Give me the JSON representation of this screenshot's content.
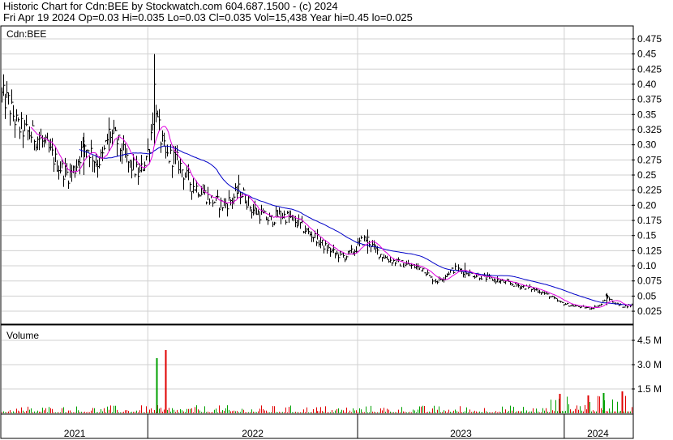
{
  "header": {
    "line1": "Historic Chart for Cdn:BEE by Stockwatch.com 604.687.1500 - (c) 2024",
    "line2": "Fri Apr 19 2024  Op=0.03  Hi=0.035  Lo=0.03  Cl=0.035  Vol=15,438  Year hi=0.45  lo=0.025"
  },
  "chart_data": [
    {
      "type": "ohlc-line",
      "ticker_label": "Cdn:BEE",
      "y_ticks": [
        "0.475",
        "0.45",
        "0.425",
        "0.40",
        "0.375",
        "0.35",
        "0.325",
        "0.30",
        "0.275",
        "0.25",
        "0.225",
        "0.20",
        "0.175",
        "0.15",
        "0.125",
        "0.10",
        "0.075",
        "0.05",
        "0.025"
      ],
      "ylim": [
        0.005,
        0.495
      ],
      "price_color": "#000000",
      "ma_short_color": "#e000e0",
      "ma_long_color": "#0000c8",
      "x_year_labels": [
        "2021",
        "2022",
        "2023",
        "2024"
      ],
      "x_year_boundaries": [
        0.232,
        0.565,
        0.893
      ],
      "price_anchors": [
        [
          0.0,
          0.38
        ],
        [
          0.01,
          0.37
        ],
        [
          0.025,
          0.33
        ],
        [
          0.04,
          0.32
        ],
        [
          0.06,
          0.31
        ],
        [
          0.075,
          0.29
        ],
        [
          0.09,
          0.265
        ],
        [
          0.105,
          0.25
        ],
        [
          0.115,
          0.26
        ],
        [
          0.13,
          0.3
        ],
        [
          0.14,
          0.29
        ],
        [
          0.15,
          0.27
        ],
        [
          0.16,
          0.28
        ],
        [
          0.17,
          0.32
        ],
        [
          0.18,
          0.31
        ],
        [
          0.19,
          0.29
        ],
        [
          0.2,
          0.27
        ],
        [
          0.21,
          0.26
        ],
        [
          0.218,
          0.25
        ],
        [
          0.225,
          0.27
        ],
        [
          0.232,
          0.29
        ],
        [
          0.238,
          0.33
        ],
        [
          0.242,
          0.4
        ],
        [
          0.246,
          0.34
        ],
        [
          0.252,
          0.31
        ],
        [
          0.26,
          0.28
        ],
        [
          0.27,
          0.28
        ],
        [
          0.28,
          0.27
        ],
        [
          0.29,
          0.25
        ],
        [
          0.3,
          0.235
        ],
        [
          0.315,
          0.225
        ],
        [
          0.33,
          0.21
        ],
        [
          0.35,
          0.2
        ],
        [
          0.365,
          0.21
        ],
        [
          0.375,
          0.225
        ],
        [
          0.385,
          0.215
        ],
        [
          0.395,
          0.195
        ],
        [
          0.41,
          0.185
        ],
        [
          0.425,
          0.175
        ],
        [
          0.44,
          0.185
        ],
        [
          0.455,
          0.18
        ],
        [
          0.47,
          0.17
        ],
        [
          0.485,
          0.155
        ],
        [
          0.5,
          0.145
        ],
        [
          0.515,
          0.13
        ],
        [
          0.53,
          0.12
        ],
        [
          0.545,
          0.115
        ],
        [
          0.56,
          0.125
        ],
        [
          0.57,
          0.14
        ],
        [
          0.58,
          0.145
        ],
        [
          0.59,
          0.13
        ],
        [
          0.6,
          0.12
        ],
        [
          0.615,
          0.11
        ],
        [
          0.63,
          0.105
        ],
        [
          0.65,
          0.1
        ],
        [
          0.67,
          0.095
        ],
        [
          0.68,
          0.08
        ],
        [
          0.69,
          0.075
        ],
        [
          0.7,
          0.08
        ],
        [
          0.71,
          0.09
        ],
        [
          0.72,
          0.095
        ],
        [
          0.735,
          0.09
        ],
        [
          0.75,
          0.085
        ],
        [
          0.77,
          0.08
        ],
        [
          0.79,
          0.075
        ],
        [
          0.81,
          0.07
        ],
        [
          0.83,
          0.065
        ],
        [
          0.85,
          0.06
        ],
        [
          0.87,
          0.05
        ],
        [
          0.885,
          0.04
        ],
        [
          0.9,
          0.035
        ],
        [
          0.92,
          0.032
        ],
        [
          0.935,
          0.03
        ],
        [
          0.95,
          0.035
        ],
        [
          0.96,
          0.05
        ],
        [
          0.97,
          0.04
        ],
        [
          0.985,
          0.033
        ],
        [
          1.0,
          0.035
        ]
      ]
    },
    {
      "type": "bar",
      "label": "Volume",
      "y_ticks": [
        "4.5 M",
        "3.0 M",
        "1.5 M"
      ],
      "ylim": [
        0,
        5.4
      ],
      "up_color": "#00a000",
      "down_color": "#e00000",
      "spikes": [
        {
          "x": 0.246,
          "value": 3.4,
          "color": "#00a000"
        },
        {
          "x": 0.26,
          "value": 3.9,
          "color": "#e00000"
        },
        {
          "x": 0.886,
          "value": 1.2,
          "color": "#e00000"
        },
        {
          "x": 0.93,
          "value": 1.1,
          "color": "#e00000"
        },
        {
          "x": 0.955,
          "value": 1.25,
          "color": "#00a000"
        },
        {
          "x": 0.985,
          "value": 1.35,
          "color": "#e00000"
        }
      ]
    }
  ]
}
